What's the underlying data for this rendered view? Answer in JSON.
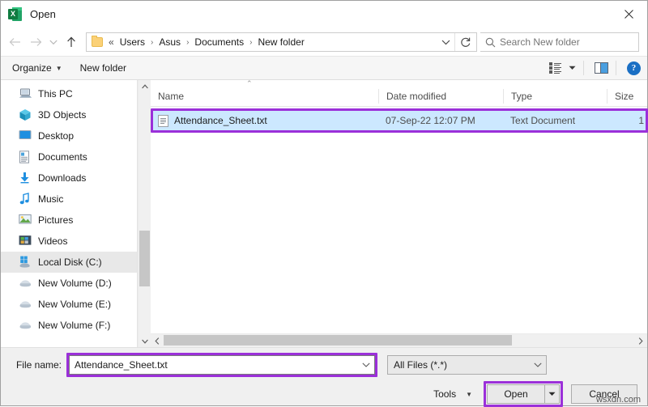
{
  "window": {
    "title": "Open",
    "app_icon": "excel-icon",
    "close_label": "✕"
  },
  "nav": {
    "back_icon": "←",
    "forward_icon": "→",
    "recent_icon": "⌄",
    "up_icon": "↑",
    "breadcrumb_overflow": "«",
    "crumbs": [
      "Users",
      "Asus",
      "Documents",
      "New folder"
    ],
    "separator": "›",
    "dropdown_icon": "⌄",
    "refresh_icon": "↻"
  },
  "search": {
    "placeholder": "Search New folder",
    "value": "",
    "icon": "search-icon"
  },
  "toolbar": {
    "organize_label": "Organize",
    "organize_caret": "▼",
    "new_folder_label": "New folder",
    "view_caret": "▼",
    "view_icon": "view-options-icon",
    "preview_pane_icon": "preview-pane-icon",
    "help_label": "?"
  },
  "sidebar": {
    "items": [
      {
        "label": "This PC",
        "icon": "this-pc-icon",
        "selected": false
      },
      {
        "label": "3D Objects",
        "icon": "3d-objects-icon",
        "selected": false
      },
      {
        "label": "Desktop",
        "icon": "desktop-icon",
        "selected": false
      },
      {
        "label": "Documents",
        "icon": "documents-icon",
        "selected": false
      },
      {
        "label": "Downloads",
        "icon": "downloads-icon",
        "selected": false
      },
      {
        "label": "Music",
        "icon": "music-icon",
        "selected": false
      },
      {
        "label": "Pictures",
        "icon": "pictures-icon",
        "selected": false
      },
      {
        "label": "Videos",
        "icon": "videos-icon",
        "selected": false
      },
      {
        "label": "Local Disk (C:)",
        "icon": "local-disk-icon",
        "selected": true
      },
      {
        "label": "New Volume (D:)",
        "icon": "drive-icon",
        "selected": false
      },
      {
        "label": "New Volume (E:)",
        "icon": "drive-icon",
        "selected": false
      },
      {
        "label": "New Volume (F:)",
        "icon": "drive-icon",
        "selected": false
      }
    ],
    "scroll_up_icon": "⌃",
    "scroll_down_icon": "⌄"
  },
  "file_list": {
    "sort_indicator": "⌃",
    "columns": [
      "Name",
      "Date modified",
      "Type",
      "Size"
    ],
    "rows": [
      {
        "name": "Attendance_Sheet.txt",
        "date_modified": "07-Sep-22 12:07 PM",
        "type": "Text Document",
        "size": "1",
        "icon": "text-file-icon",
        "selected": true
      }
    ],
    "hscroll_left_icon": "‹",
    "hscroll_right_icon": "›"
  },
  "footer": {
    "file_name_label": "File name:",
    "file_name_value": "Attendance_Sheet.txt",
    "file_name_caret": "⌄",
    "filter_value": "All Files (*.*)",
    "filter_caret": "⌄",
    "tools_label": "Tools",
    "tools_caret": "▼",
    "open_label": "Open",
    "open_caret": "▼",
    "cancel_label": "Cancel"
  },
  "watermark": {
    "text": "wsxdn.com"
  },
  "colors": {
    "annotation": "#9b30d9",
    "selection": "#cce8ff",
    "accent": "#1a6fc4"
  }
}
